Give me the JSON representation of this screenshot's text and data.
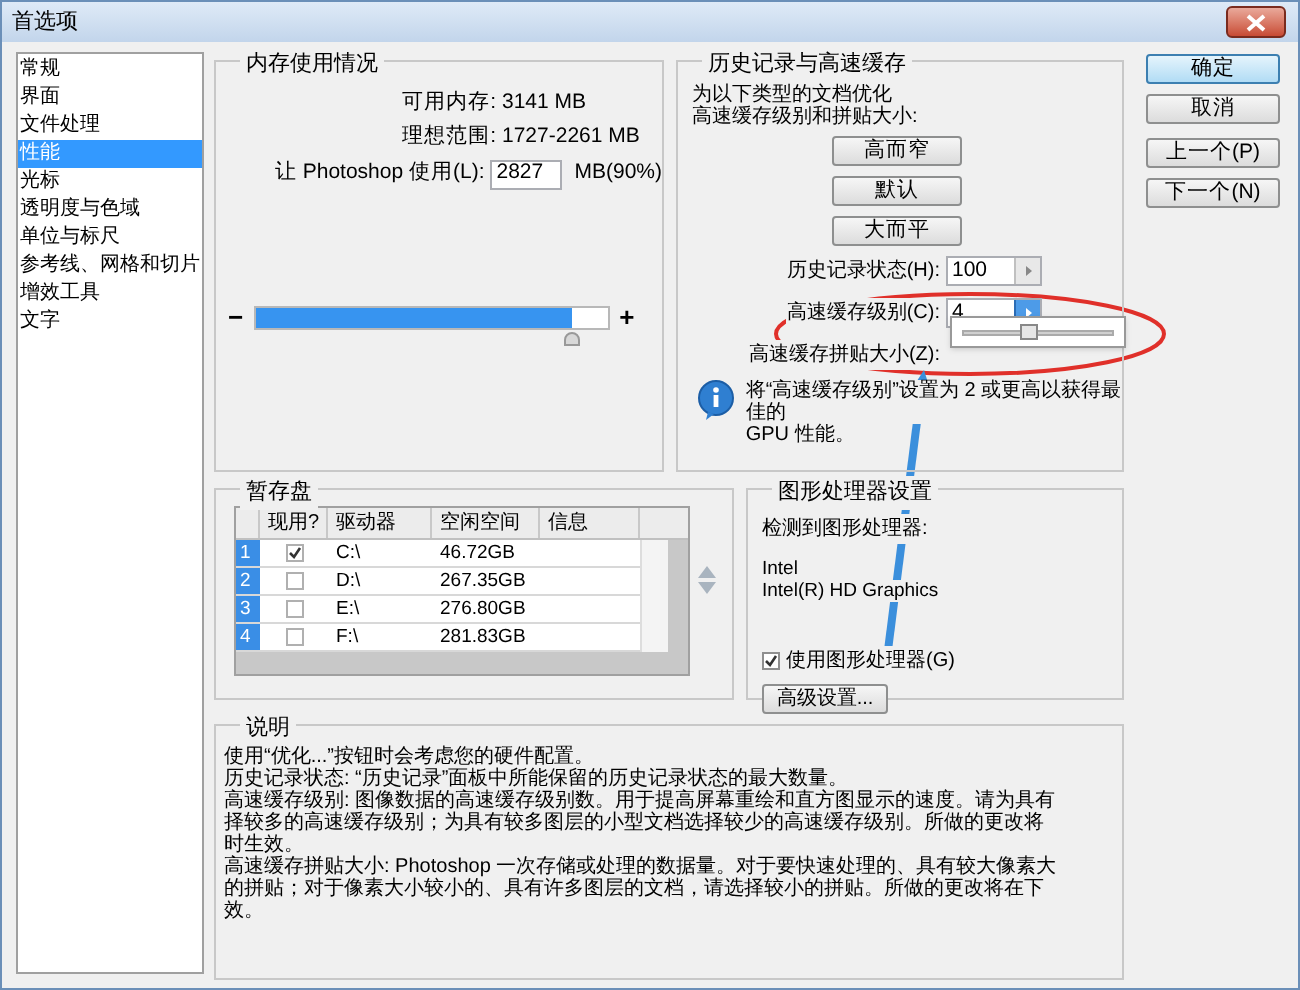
{
  "window": {
    "title": "首选项"
  },
  "sidebar": {
    "items": [
      {
        "label": "常规",
        "selected": false
      },
      {
        "label": "界面",
        "selected": false
      },
      {
        "label": "文件处理",
        "selected": false
      },
      {
        "label": "性能",
        "selected": true
      },
      {
        "label": "光标",
        "selected": false
      },
      {
        "label": "透明度与色域",
        "selected": false
      },
      {
        "label": "单位与标尺",
        "selected": false
      },
      {
        "label": "参考线、网格和切片",
        "selected": false
      },
      {
        "label": "增效工具",
        "selected": false
      },
      {
        "label": "文字",
        "selected": false
      }
    ]
  },
  "memory": {
    "title": "内存使用情况",
    "available_label": "可用内存:",
    "available": "3141 MB",
    "ideal_label": "理想范围:",
    "ideal": "1727-2261 MB",
    "use_label": "让 Photoshop 使用(L):",
    "use_value": "2827",
    "use_unit": "MB(90%)",
    "slider": {
      "minus": "−",
      "plus": "+",
      "level": 0.9
    }
  },
  "history": {
    "title": "历史记录与高速缓存",
    "intro": [
      "为以下类型的文档优化",
      "高速缓存级别和拼贴大小:"
    ],
    "presets": [
      "高而窄",
      "默认",
      "大而平"
    ],
    "fields": [
      {
        "label": "历史记录状态(H):",
        "value": "100",
        "active": false
      },
      {
        "label": "高速缓存级别(C):",
        "value": "4",
        "active": true
      }
    ],
    "tile_label": "高速缓存拼贴大小(Z):",
    "popup": {
      "level": 0.43
    },
    "tip": [
      "将“高速缓存级别”设置为 2 或更高以获得最佳的",
      "GPU 性能。"
    ]
  },
  "buttons": [
    {
      "label": "确定",
      "default": true
    },
    {
      "label": "取消",
      "default": false
    },
    {
      "label": "上一个(P)",
      "default": false
    },
    {
      "label": "下一个(N)",
      "default": false
    }
  ],
  "scratch": {
    "title": "暂存盘",
    "columns": [
      "现用?",
      "驱动器",
      "空闲空间",
      "信息"
    ],
    "rows": [
      {
        "index": "1",
        "active": true,
        "drive": "C:\\",
        "free": "46.72GB"
      },
      {
        "index": "2",
        "active": false,
        "drive": "D:\\",
        "free": "267.35GB"
      },
      {
        "index": "3",
        "active": false,
        "drive": "E:\\",
        "free": "276.80GB"
      },
      {
        "index": "4",
        "active": false,
        "drive": "F:\\",
        "free": "281.83GB"
      }
    ]
  },
  "gpu": {
    "title": "图形处理器设置",
    "detected_label": "检测到图形处理器:",
    "lines": [
      "Intel",
      "Intel(R) HD Graphics"
    ],
    "use_gpu": {
      "label": "使用图形处理器(G)",
      "checked": true
    },
    "advanced": "高级设置..."
  },
  "description": {
    "title": "说明",
    "lines": [
      "使用“优化...”按钮时会考虑您的硬件配置。",
      "历史记录状态: “历史记录”面板中所能保留的历史记录状态的最大数量。",
      "高速缓存级别: 图像数据的高速缓存级别数。用于提高屏幕重绘和直方图显示的速度。请为具有",
      "择较多的高速缓存级别；为具有较多图层的小型文档选择较少的高速缓存级别。所做的更改将",
      "时生效。",
      "高速缓存拼贴大小: Photoshop 一次存储或处理的数据量。对于要快速处理的、具有较大像素大",
      "的拼贴；对于像素大小较小的、具有许多图层的文档，请选择较小的拼贴。所做的更改将在下",
      "效。"
    ]
  }
}
